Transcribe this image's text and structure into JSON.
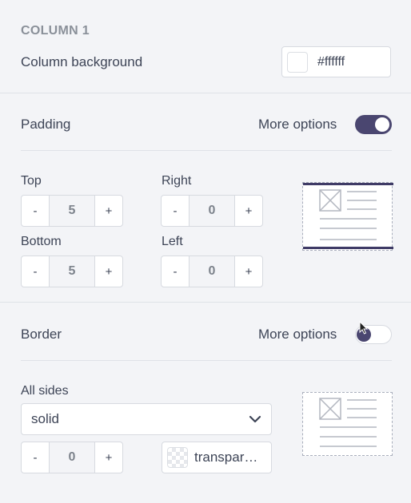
{
  "column": {
    "heading": "COLUMN 1",
    "background_label": "Column background",
    "background_value": "#ffffff"
  },
  "padding": {
    "label": "Padding",
    "more_options_label": "More options",
    "more_options_on": true,
    "top_label": "Top",
    "top_value": "5",
    "right_label": "Right",
    "right_value": "0",
    "bottom_label": "Bottom",
    "bottom_value": "5",
    "left_label": "Left",
    "left_value": "0"
  },
  "border": {
    "label": "Border",
    "more_options_label": "More options",
    "more_options_on": false,
    "all_sides_label": "All sides",
    "style_value": "solid",
    "width_value": "0",
    "color_value": "transpar…"
  },
  "stepper": {
    "minus": "-",
    "plus": "+"
  },
  "colors": {
    "accent": "#4a4670",
    "background": "#f3f4f7",
    "border": "#d7dae0"
  }
}
